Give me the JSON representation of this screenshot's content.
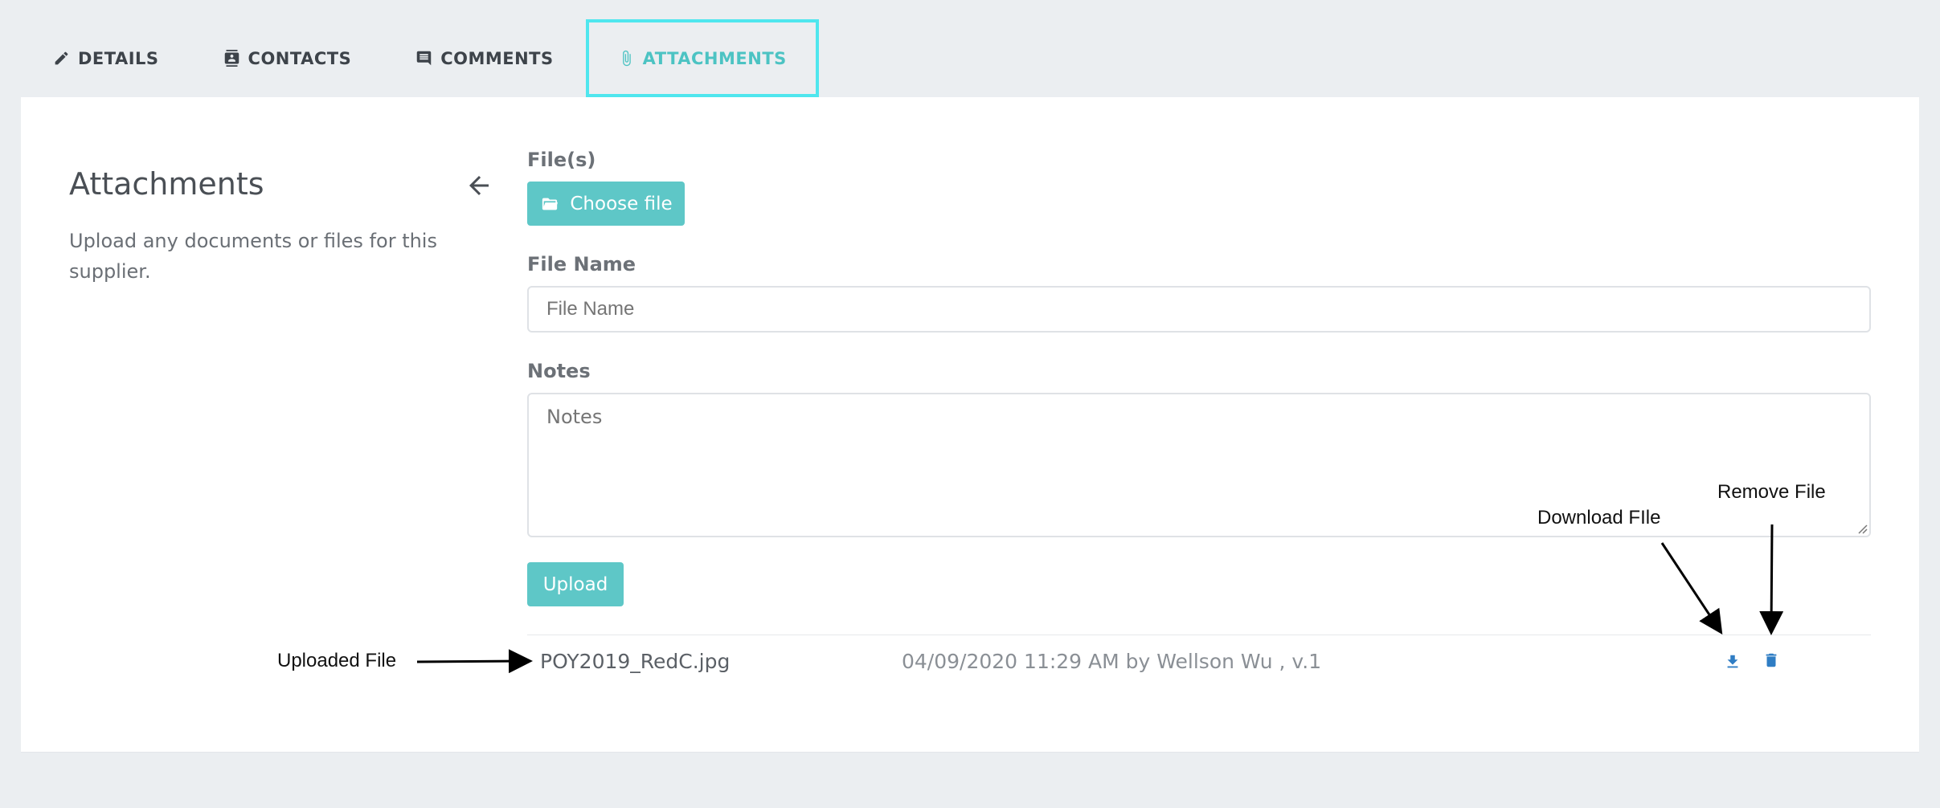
{
  "tabs": [
    {
      "label": "DETAILS",
      "icon": "pencil-icon",
      "active": false
    },
    {
      "label": "CONTACTS",
      "icon": "contact-book-icon",
      "active": false
    },
    {
      "label": "COMMENTS",
      "icon": "comment-icon",
      "active": false
    },
    {
      "label": "ATTACHMENTS",
      "icon": "paperclip-icon",
      "active": true
    }
  ],
  "section": {
    "title": "Attachments",
    "description": "Upload any documents or files for this supplier."
  },
  "form": {
    "files_label": "File(s)",
    "choose_file_label": "Choose file",
    "file_name_label": "File Name",
    "file_name_placeholder": "File Name",
    "notes_label": "Notes",
    "notes_placeholder": "Notes",
    "upload_label": "Upload"
  },
  "attachment": {
    "file_name": "POY2019_RedC.jpg",
    "meta": "04/09/2020 11:29 AM by Wellson Wu , v.1"
  },
  "annotations": {
    "uploaded_file": "Uploaded File",
    "download_file": "Download FIle",
    "remove_file": "Remove File"
  },
  "colors": {
    "accent": "#5ec7c7",
    "active_tab_border": "#4fe6ee",
    "icon_blue": "#2f7dc4",
    "background": "#ebeef1"
  }
}
